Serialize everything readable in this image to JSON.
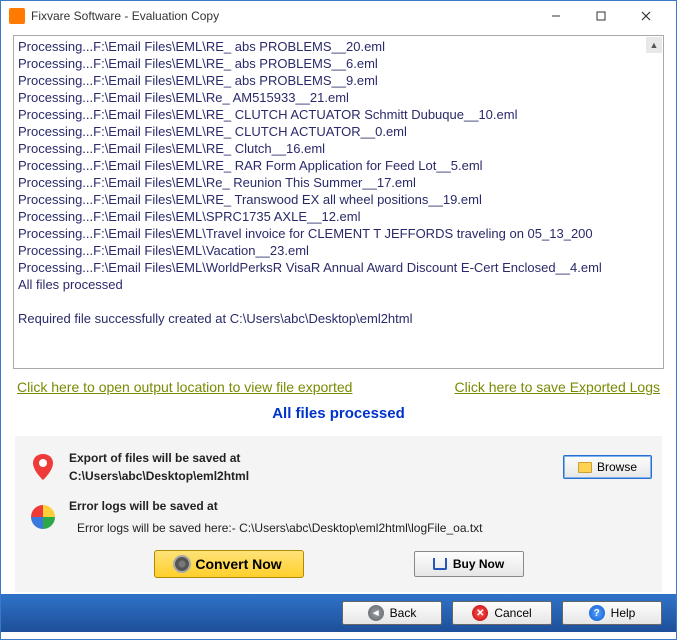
{
  "window": {
    "title": "Fixvare Software - Evaluation Copy"
  },
  "log": {
    "lines": [
      "Processing...F:\\Email Files\\EML\\RE_ abs PROBLEMS__20.eml",
      "Processing...F:\\Email Files\\EML\\RE_ abs PROBLEMS__6.eml",
      "Processing...F:\\Email Files\\EML\\RE_ abs PROBLEMS__9.eml",
      "Processing...F:\\Email Files\\EML\\Re_ AM515933__21.eml",
      "Processing...F:\\Email Files\\EML\\RE_ CLUTCH ACTUATOR Schmitt Dubuque__10.eml",
      "Processing...F:\\Email Files\\EML\\RE_ CLUTCH ACTUATOR__0.eml",
      "Processing...F:\\Email Files\\EML\\RE_ Clutch__16.eml",
      "Processing...F:\\Email Files\\EML\\RE_ RAR Form Application for Feed Lot__5.eml",
      "Processing...F:\\Email Files\\EML\\Re_ Reunion This Summer__17.eml",
      "Processing...F:\\Email Files\\EML\\RE_ Transwood EX all wheel positions__19.eml",
      "Processing...F:\\Email Files\\EML\\SPRC1735 AXLE__12.eml",
      "Processing...F:\\Email Files\\EML\\Travel invoice for CLEMENT T JEFFORDS traveling on 05_13_200",
      "Processing...F:\\Email Files\\EML\\Vacation__23.eml",
      "Processing...F:\\Email Files\\EML\\WorldPerksR VisaR Annual Award Discount E-Cert Enclosed__4.eml",
      "All files processed",
      "",
      "Required file successfully created at C:\\Users\\abc\\Desktop\\eml2html"
    ]
  },
  "links": {
    "open_output": "Click here to open output location to view file exported",
    "save_logs": "Click here to save Exported Logs"
  },
  "status": "All files processed",
  "panel": {
    "export_label": "Export of files will be saved at",
    "export_path": "C:\\Users\\abc\\Desktop\\eml2html",
    "browse": "Browse",
    "error_label": "Error logs will be saved at",
    "error_path": "Error logs will be saved here:- C:\\Users\\abc\\Desktop\\eml2html\\logFile_oa.txt"
  },
  "actions": {
    "convert": "Convert Now",
    "buy": "Buy Now"
  },
  "nav": {
    "back": "Back",
    "cancel": "Cancel",
    "help": "Help"
  }
}
